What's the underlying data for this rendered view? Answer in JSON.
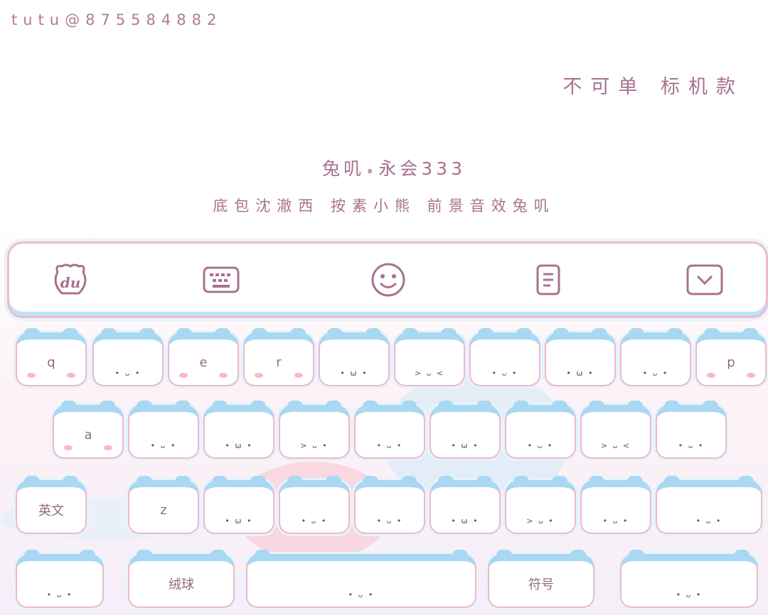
{
  "header": {
    "handle": "tutu@875584882",
    "notice": "不可单 标机款",
    "title_left": "兔叽",
    "title_mark": "๑",
    "title_right": "永会333",
    "credits": "底包沈澈西 按素小熊 前景音效兔叽"
  },
  "toolbar": {
    "icons": [
      "du-logo-icon",
      "keyboard-icon",
      "emoji-icon",
      "clipboard-icon",
      "collapse-icon"
    ]
  },
  "keys": {
    "row1": [
      "q",
      "",
      "e",
      "r",
      "",
      "",
      "",
      "",
      "",
      "p"
    ],
    "row2": [
      "a",
      "",
      "",
      "",
      "",
      "",
      "",
      "",
      ""
    ],
    "row3": [
      "英文",
      "z",
      "",
      "",
      "",
      "",
      "",
      "",
      ""
    ],
    "row4": [
      "",
      "绒球",
      "",
      "符号",
      ""
    ]
  },
  "colors": {
    "accent_pink": "#f1b7c8",
    "accent_blue": "#a9d8f2",
    "text": "#a8718f"
  }
}
